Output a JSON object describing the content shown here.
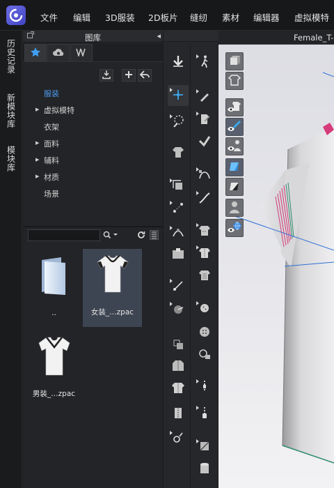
{
  "menu": {
    "items": [
      "文件",
      "编辑",
      "3D服装",
      "2D板片",
      "缝纫",
      "素材",
      "编辑器",
      "虚拟模特"
    ]
  },
  "vertical_tabs": [
    "历史记录",
    "新模块库",
    "模块库"
  ],
  "library": {
    "title": "图库",
    "tabs": [
      "star-icon",
      "cloud-icon",
      "double-stripe-icon"
    ],
    "toolbar": [
      "download-icon",
      "add-icon",
      "back-icon"
    ],
    "tree": [
      {
        "label": "服装",
        "active": true,
        "expandable": false
      },
      {
        "label": "虚拟模特",
        "active": false,
        "expandable": true
      },
      {
        "label": "衣架",
        "active": false,
        "expandable": false
      },
      {
        "label": "面料",
        "active": false,
        "expandable": true
      },
      {
        "label": "辅料",
        "active": false,
        "expandable": true
      },
      {
        "label": "材质",
        "active": false,
        "expandable": true
      },
      {
        "label": "场景",
        "active": false,
        "expandable": false
      }
    ],
    "search": {
      "value": "",
      "placeholder": ""
    },
    "files": [
      {
        "label": "..",
        "kind": "folder",
        "selected": false
      },
      {
        "label": "女装_…zpac",
        "kind": "tshirt-women",
        "selected": true
      },
      {
        "label": "男装_…zpac",
        "kind": "tshirt-men",
        "selected": false
      }
    ]
  },
  "viewport": {
    "title": "Female_T-",
    "toolbar": [
      "avatar-solid-icon",
      "garment-outline-icon",
      "eye-shirt-icon",
      "eye-brush-icon",
      "eye-avatar-icon",
      "texture-icon",
      "shadow-icon",
      "avatar-gray-icon",
      "eye-globe-icon"
    ],
    "accent": "#2f6fd6",
    "garment_stripe": "#d63b7a"
  },
  "colors": {
    "active_tree": "#4d9bf0",
    "selected_file": "#3e4552",
    "tool_highlight": "#3aa7e8"
  }
}
